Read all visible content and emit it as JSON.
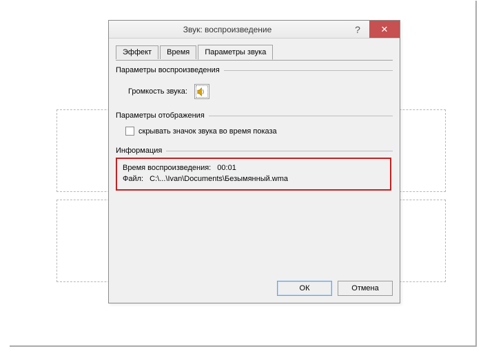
{
  "dialog": {
    "title": "Звук: воспроизведение"
  },
  "tabs": {
    "t0": "Эффект",
    "t1": "Время",
    "t2": "Параметры звука"
  },
  "playback": {
    "group_label": "Параметры воспроизведения",
    "volume_label": "Громкость звука:"
  },
  "display": {
    "group_label": "Параметры отображения",
    "hide_icon_label": "скрывать значок звука во время показа"
  },
  "info": {
    "group_label": "Информация",
    "time_label": "Время воспроизведения:",
    "time_value": "00:01",
    "file_label": "Файл:",
    "file_value": "C:\\...\\Ivan\\Documents\\Безымянный.wma"
  },
  "buttons": {
    "ok": "ОК",
    "cancel": "Отмена"
  }
}
